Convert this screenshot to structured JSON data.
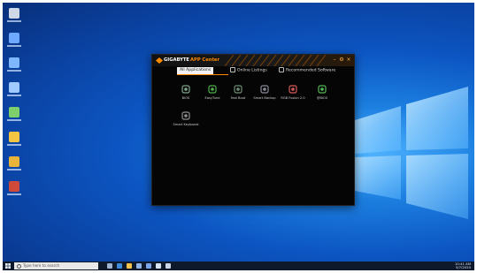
{
  "desktop": {
    "icons": [
      {
        "icon": "recycle-bin-icon",
        "color": "#cfd8e6"
      },
      {
        "icon": "pc-icon",
        "color": "#6fa8ff"
      },
      {
        "icon": "user-folder-icon",
        "color": "#7fb7ff"
      },
      {
        "icon": "network-icon",
        "color": "#9fc9ff"
      },
      {
        "icon": "control-panel-icon",
        "color": "#7ccf6a"
      },
      {
        "icon": "folder-icon",
        "color": "#f4c542"
      },
      {
        "icon": "chrome-icon",
        "color": "#e8b53a"
      },
      {
        "icon": "app-icon",
        "color": "#d04a3a"
      }
    ]
  },
  "app_window": {
    "brand": "GIGABYTE",
    "title": "APP Center",
    "accent": "#ff8a00",
    "controls": [
      "minimize-icon",
      "settings-icon",
      "close-icon"
    ],
    "tabs": [
      {
        "label": "All Applications",
        "active": true
      },
      {
        "label": "Online Listings",
        "active": false
      },
      {
        "label": "Recommended Software",
        "active": false
      }
    ],
    "apps": [
      {
        "name": "BIOS",
        "icon": "bios-icon",
        "color": "#7ea48a"
      },
      {
        "name": "EasyTune",
        "icon": "easytune-icon",
        "color": "#4fae4a"
      },
      {
        "name": "Fast Boot",
        "icon": "fast-boot-icon",
        "color": "#6f8f73"
      },
      {
        "name": "Smart Backup",
        "icon": "smart-backup-icon",
        "color": "#8a8a9a"
      },
      {
        "name": "RGB Fusion 2.0",
        "icon": "rgb-fusion-icon",
        "color": "#d65a5a"
      },
      {
        "name": "@BIOS",
        "icon": "at-bios-icon",
        "color": "#55b655"
      },
      {
        "name": "Smart Keyboard",
        "icon": "smart-keyboard-icon",
        "color": "#8f8f8f"
      }
    ]
  },
  "taskbar": {
    "search_placeholder": "Type here to search",
    "tray_time": "10:41 AM",
    "tray_date": "5/7/2020",
    "pinned": [
      "task-view-icon",
      "edge-icon",
      "file-explorer-icon",
      "store-icon",
      "mail-icon",
      "app-center-icon",
      "taskbar-app-icon"
    ]
  }
}
